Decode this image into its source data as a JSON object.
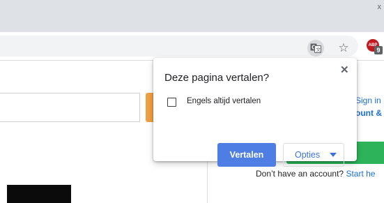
{
  "browser": {
    "window_control": "x",
    "toolbar": {
      "translate_icon": "translate-icon",
      "star_icon": "star-icon",
      "star_glyph": "☆",
      "extension": {
        "label": "ABP",
        "badge": "9",
        "color": "#c2191f"
      }
    }
  },
  "page": {
    "signin_text": "Sign in",
    "account_text": "ount &",
    "no_account_text": "Don’t have an account?",
    "start_link": "Start he"
  },
  "translate_popup": {
    "title": "Deze pagina vertalen?",
    "close_glyph": "✕",
    "checkbox_label": "Engels altijd vertalen",
    "translate_button": "Vertalen",
    "options_button": "Opties",
    "accent_color": "#4e7de4"
  }
}
